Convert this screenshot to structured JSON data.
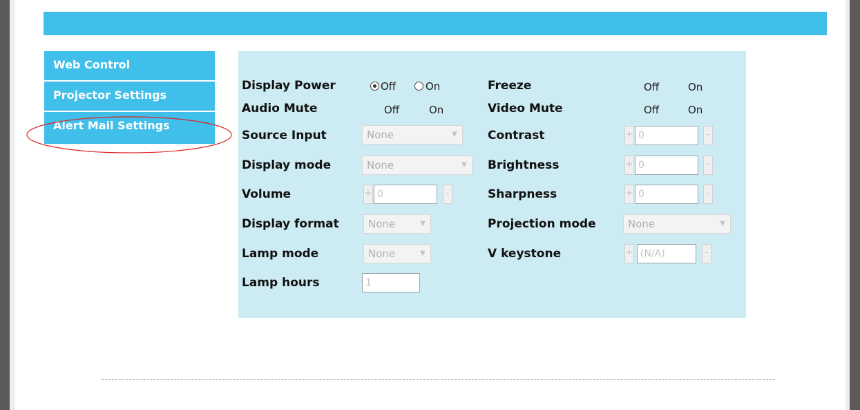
{
  "menu": {
    "items": [
      {
        "label": "Web Control"
      },
      {
        "label": "Projector Settings"
      },
      {
        "label": "Alert Mail Settings"
      }
    ]
  },
  "controls": {
    "display_power": {
      "label": "Display Power",
      "off": "Off",
      "on": "On",
      "selected": "Off"
    },
    "audio_mute": {
      "label": "Audio Mute",
      "off": "Off",
      "on": "On"
    },
    "source_input": {
      "label": "Source Input",
      "value": "None"
    },
    "display_mode": {
      "label": "Display mode",
      "value": "None"
    },
    "volume": {
      "label": "Volume",
      "value": "0",
      "plus": "+",
      "minus": "-"
    },
    "display_format": {
      "label": "Display format",
      "value": "None"
    },
    "lamp_mode": {
      "label": "Lamp mode",
      "value": "None"
    },
    "lamp_hours": {
      "label": "Lamp hours",
      "value": "1"
    },
    "freeze": {
      "label": "Freeze",
      "off": "Off",
      "on": "On"
    },
    "video_mute": {
      "label": "Video Mute",
      "off": "Off",
      "on": "On"
    },
    "contrast": {
      "label": "Contrast",
      "value": "0",
      "plus": "+",
      "minus": "-"
    },
    "brightness": {
      "label": "Brightness",
      "value": "0",
      "plus": "+",
      "minus": "-"
    },
    "sharpness": {
      "label": "Sharpness",
      "value": "0",
      "plus": "+",
      "minus": "-"
    },
    "projection_mode": {
      "label": "Projection mode",
      "value": "None"
    },
    "v_keystone": {
      "label": "V keystone",
      "value": "(N/A)",
      "plus": "+",
      "minus": "-"
    }
  },
  "colors": {
    "accent": "#3fbfea",
    "panel": "#cdebf2",
    "highlight": "#e02020"
  }
}
